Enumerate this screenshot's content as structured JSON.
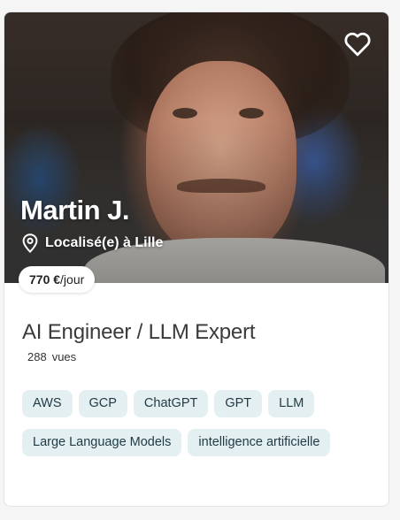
{
  "profile": {
    "name": "Martin J.",
    "location": "Localisé(e) à Lille",
    "rate_amount": "770 €",
    "rate_unit": "/jour",
    "title": "AI Engineer / LLM Expert",
    "views_count": "288",
    "views_label": "vues"
  },
  "tags": [
    "AWS",
    "GCP",
    "ChatGPT",
    "GPT",
    "LLM",
    "Large Language Models",
    "intelligence artificielle"
  ],
  "icons": {
    "favorite": "heart-outline-icon",
    "location": "map-pin-icon"
  },
  "colors": {
    "tag_background": "#e4eff2",
    "tag_text": "#1f3a44",
    "title_text": "#3a3a3a"
  }
}
